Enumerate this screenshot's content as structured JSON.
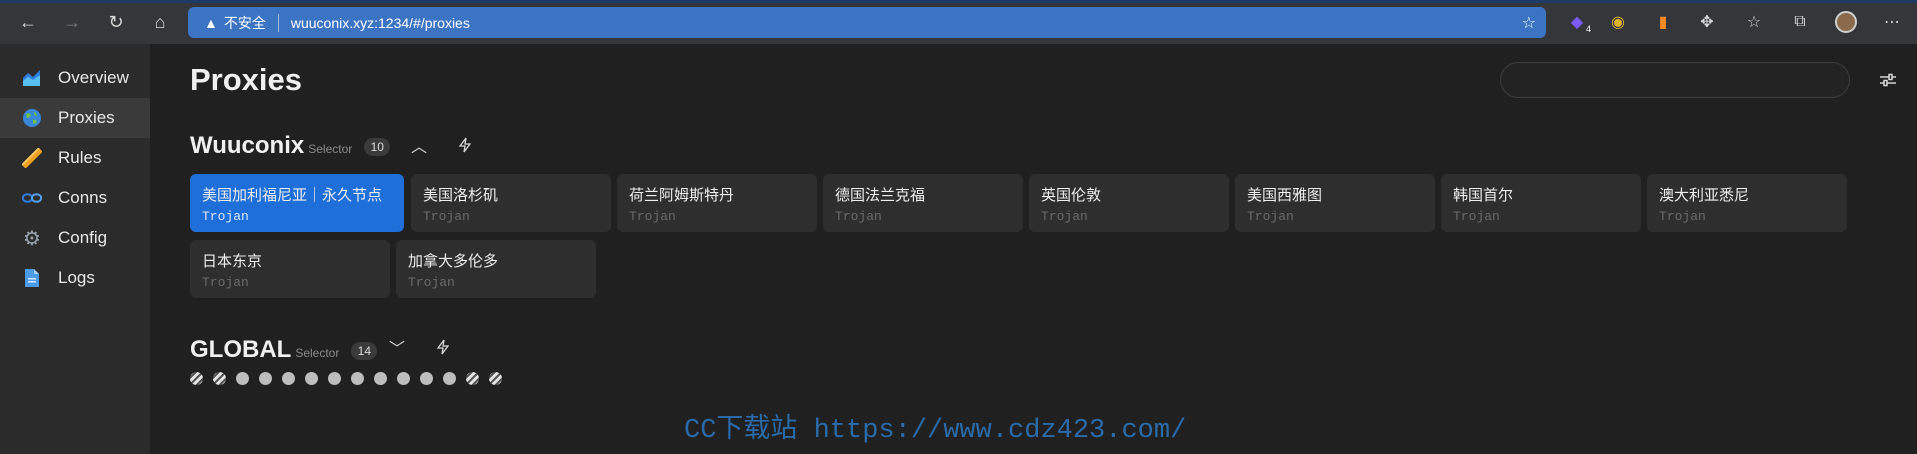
{
  "browser": {
    "security_label": "不安全",
    "url": "wuuconix.xyz:1234/#/proxies",
    "extension_badge": "4"
  },
  "sidebar": {
    "items": [
      {
        "label": "Overview",
        "icon": "chart-area-icon"
      },
      {
        "label": "Proxies",
        "icon": "globe-icon",
        "active": true
      },
      {
        "label": "Rules",
        "icon": "ruler-icon"
      },
      {
        "label": "Conns",
        "icon": "link-icon"
      },
      {
        "label": "Config",
        "icon": "gear-icon"
      },
      {
        "label": "Logs",
        "icon": "document-icon"
      }
    ]
  },
  "page": {
    "title": "Proxies",
    "search_placeholder": ""
  },
  "groups": [
    {
      "name": "Wuuconix",
      "type": "Selector",
      "count": "10",
      "proxies": [
        {
          "name": "美国加利福尼亚｜永久节点",
          "type": "Trojan",
          "selected": true
        },
        {
          "name": "美国洛杉矶",
          "type": "Trojan"
        },
        {
          "name": "荷兰阿姆斯特丹",
          "type": "Trojan"
        },
        {
          "name": "德国法兰克福",
          "type": "Trojan"
        },
        {
          "name": "英国伦敦",
          "type": "Trojan"
        },
        {
          "name": "美国西雅图",
          "type": "Trojan"
        },
        {
          "name": "韩国首尔",
          "type": "Trojan"
        },
        {
          "name": "澳大利亚悉尼",
          "type": "Trojan"
        },
        {
          "name": "日本东京",
          "type": "Trojan"
        },
        {
          "name": "加拿大多伦多",
          "type": "Trojan"
        }
      ]
    },
    {
      "name": "GLOBAL",
      "type": "Selector",
      "count": "14",
      "collapsed": true,
      "dot_pattern": [
        "striped",
        "striped",
        "solid",
        "solid",
        "solid",
        "solid",
        "solid",
        "solid",
        "solid",
        "solid",
        "solid",
        "solid",
        "striped",
        "striped"
      ]
    }
  ],
  "watermark": "CC下载站 https://www.cdz423.com/",
  "colors": {
    "accent": "#1e6fd9",
    "address_bar": "#3b74c2",
    "background": "#202020",
    "sidebar": "#2b2b2b",
    "card": "#2e2e2e"
  }
}
